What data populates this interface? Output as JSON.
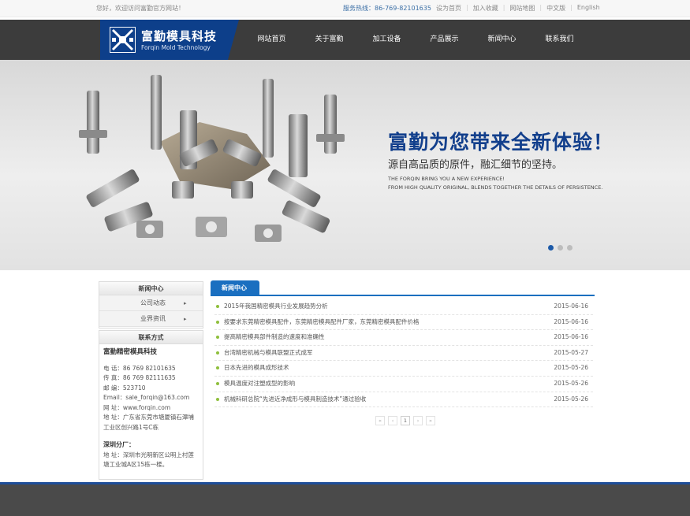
{
  "topbar": {
    "welcome": "您好，欢迎访问富勤官方网站！",
    "hotline_label": "服务热线：",
    "hotline_number": "86-769-82101635",
    "links": [
      "设为首页",
      "加入收藏",
      "网站地图",
      "中文版",
      "English"
    ]
  },
  "logo": {
    "cn": "富勤模具科技",
    "en": "Forqin Mold Technology"
  },
  "nav": {
    "items": [
      "网站首页",
      "关于富勤",
      "加工设备",
      "产品展示",
      "新闻中心",
      "联系我们"
    ]
  },
  "banner": {
    "slogan": "富勤为您带来全新体验！",
    "subtitle": "源自高品质的原件，融汇细节的坚持。",
    "en_line1": "THE FORQIN BRING YOU A NEW EXPERIENCE!",
    "en_line2": "FROM HIGH QUALITY ORIGINAL, BLENDS TOGETHER THE DETAILS OF PERSISTENCE.",
    "slide_count": 3,
    "active_slide": 1
  },
  "sidebar": {
    "news_title": "新闻中心",
    "links": [
      "公司动态",
      "业界资讯"
    ],
    "arrow_glyph": "▸",
    "contact_title": "联系方式",
    "company": "富勤精密模具科技",
    "phone": "电 话：86 769 82101635",
    "fax": "传 真：86 769 82111635",
    "zip": "邮 编：523710",
    "email": "Email：sale_forqin@163.com",
    "web": "网 址：www.forqin.com",
    "address": "地 址：广东省东莞市塘厦镇石潭埔工业区创兴路1号C栋",
    "branch_title": "深圳分厂：",
    "branch_address": "地 址：深圳市光明新区公明上村莲塘工业城A区15栋一楼。"
  },
  "news": {
    "tab": "新闻中心",
    "items": [
      {
        "title": "2015年我国精密模具行业发展趋势分析",
        "date": "2015-06-16"
      },
      {
        "title": "按要求东莞精密模具配件，东莞精密模具配件厂家，东莞精密模具配件价格",
        "date": "2015-06-16"
      },
      {
        "title": "提高精密模具部件制造的速度和准确性",
        "date": "2015-06-16"
      },
      {
        "title": "台湾精密机械与模具联盟正式成军",
        "date": "2015-05-27"
      },
      {
        "title": "日本先进的模具成形技术",
        "date": "2015-05-26"
      },
      {
        "title": "模具温度对注塑成型的影响",
        "date": "2015-05-26"
      },
      {
        "title": "机械科研总院“先进近净成形与模具制造技术”通过验收",
        "date": "2015-05-26"
      }
    ],
    "pager": {
      "first": "«",
      "prev": "‹",
      "current": "1",
      "next": "›",
      "last": "»"
    }
  },
  "colors": {
    "brand_blue": "#0d3f8a",
    "tab_blue": "#1a6fc0",
    "nav_bg": "#3c3c3c",
    "bullet_green": "#8fbf3c",
    "footer_bg": "#4a4a4a"
  },
  "icons": {
    "logo_mark": "forqin-logo-icon",
    "news_bullet": "bullet-dot-icon",
    "side_arrow": "caret-right-icon"
  }
}
